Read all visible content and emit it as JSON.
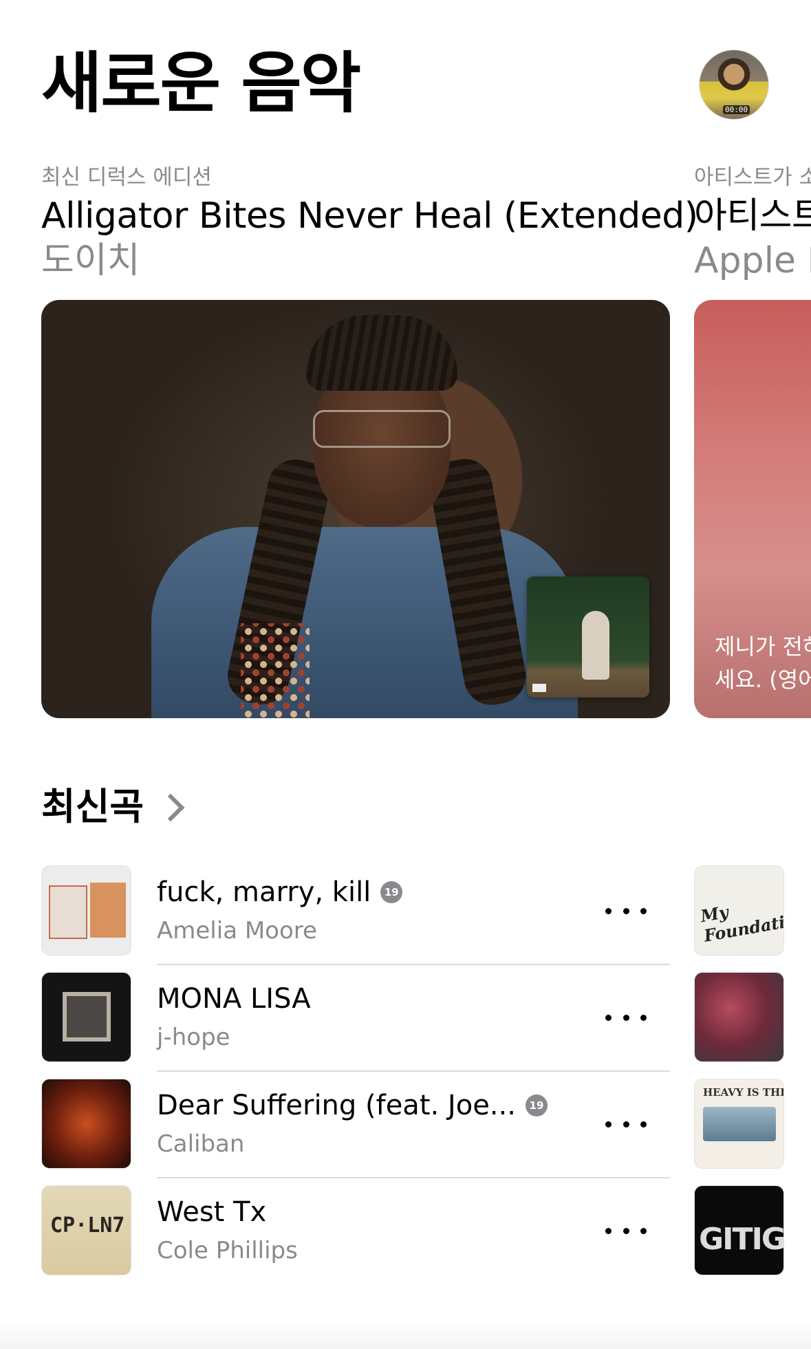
{
  "header": {
    "title": "새로운 음악",
    "avatar_badge": "00:00"
  },
  "featured": [
    {
      "eyebrow": "최신 디럭스 에디션",
      "title": "Alligator Bites Never Heal (Extended)",
      "subtitle": "도이치"
    },
    {
      "eyebrow": "아티스트가 소",
      "title": "아티스트",
      "subtitle": "Apple M",
      "card_text_line1": "제니가 전하",
      "card_text_line2": "세요. (영어"
    }
  ],
  "latest_songs": {
    "section_title": "최신곡",
    "items": [
      {
        "title": "fuck, marry, kill",
        "artist": "Amelia Moore",
        "explicit": true,
        "badge": "19"
      },
      {
        "title": "MONA LISA",
        "artist": "j-hope",
        "explicit": false
      },
      {
        "title": "Dear Suffering (feat. Joe...",
        "artist": "Caliban",
        "explicit": true,
        "badge": "19"
      },
      {
        "title": "West Tx",
        "artist": "Cole Phillips",
        "explicit": false,
        "art_text": "CP·LN7"
      }
    ],
    "side_column_art_text": [
      "My Foundation",
      "",
      "HEAVY IS THE HEAD",
      "GITIG"
    ]
  },
  "colors": {
    "primary_text": "#000000",
    "secondary_text": "#8a8a8e",
    "divider": "#dcdcdf",
    "background": "#ffffff"
  }
}
